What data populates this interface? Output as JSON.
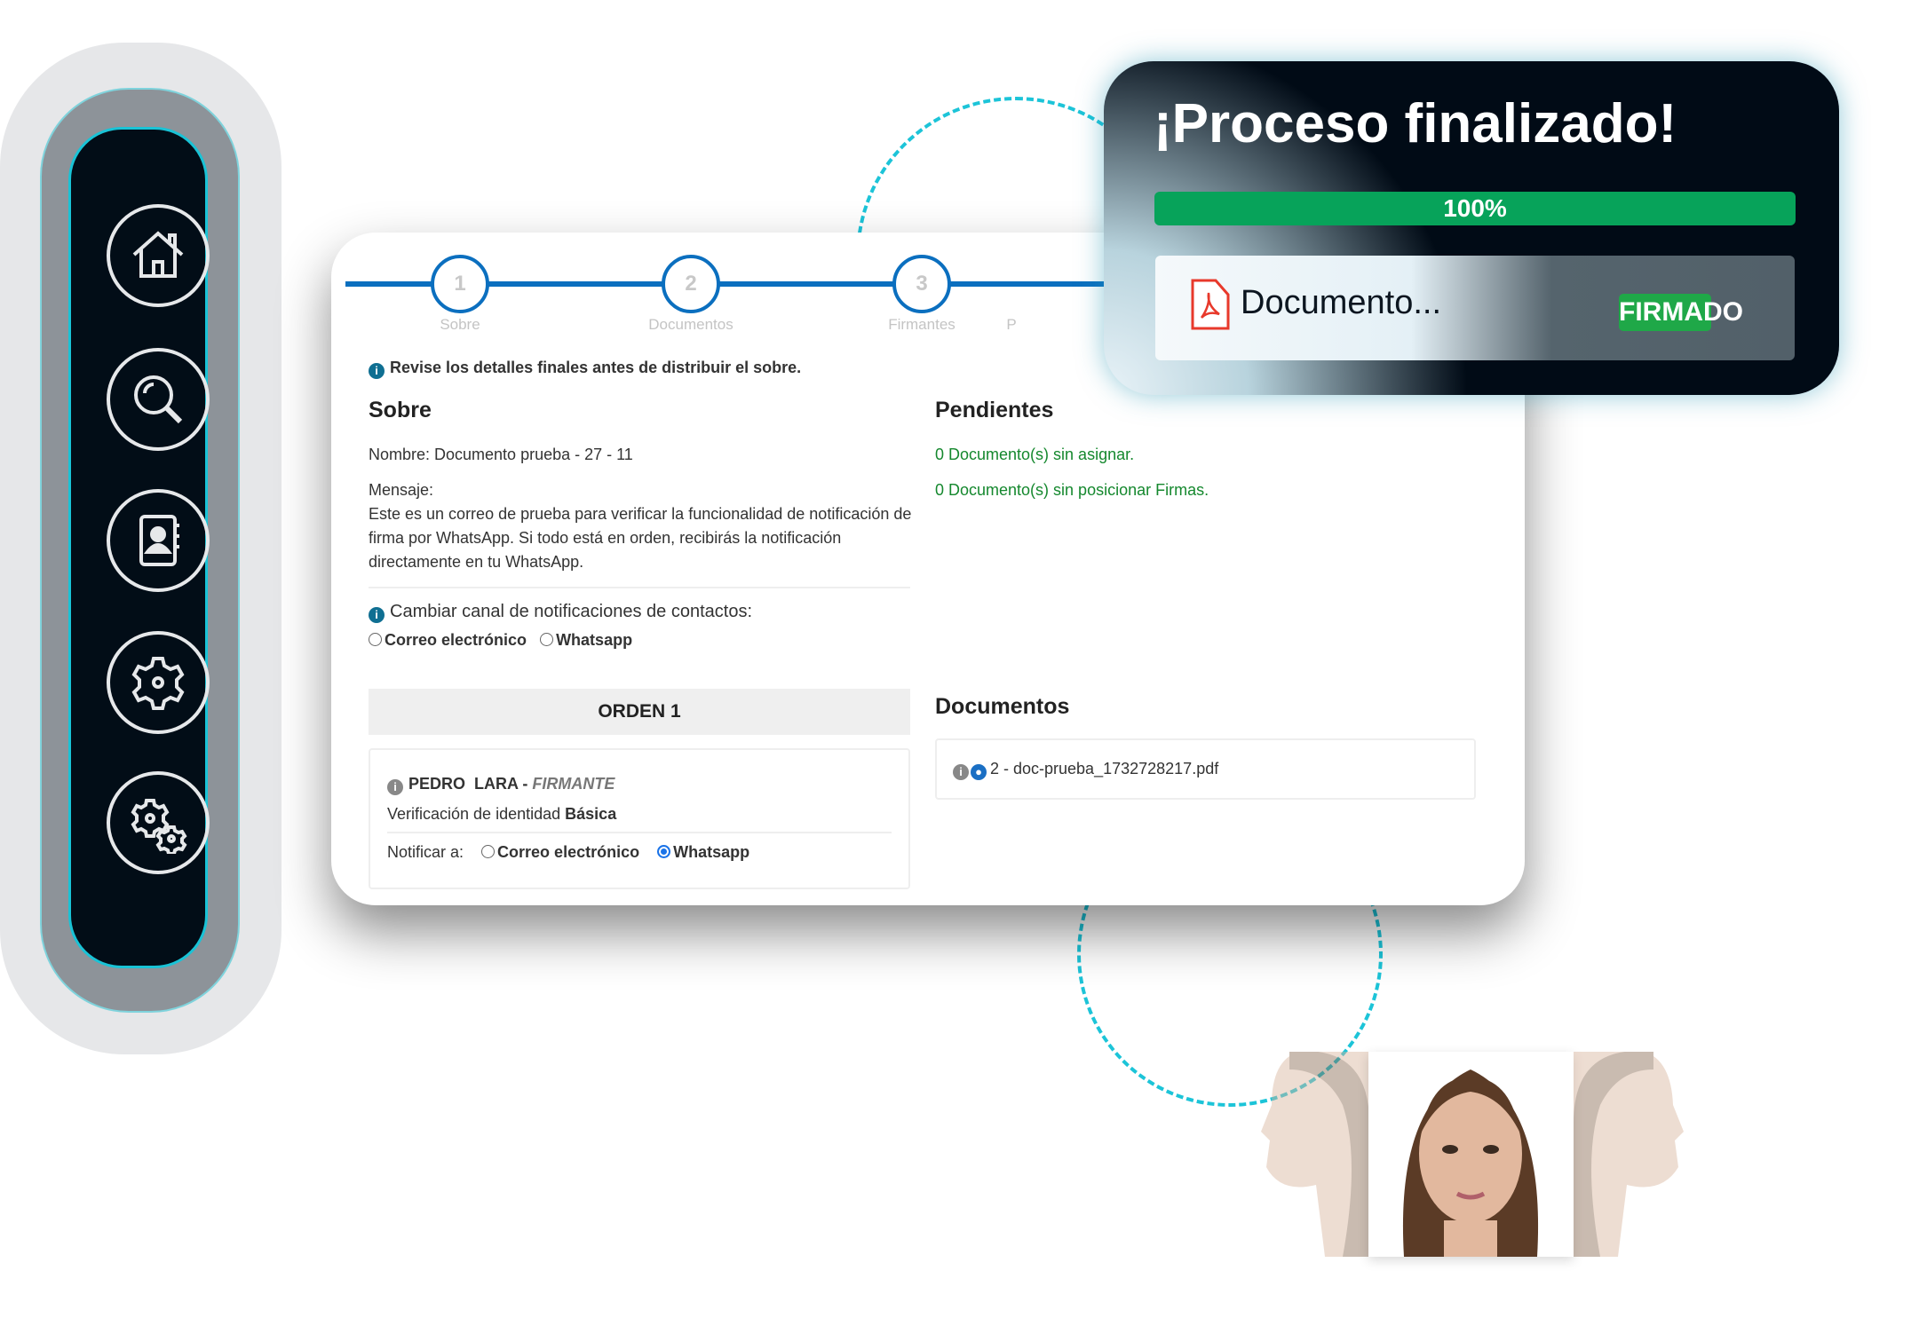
{
  "sidebar": {
    "items": [
      {
        "icon": "home-icon"
      },
      {
        "icon": "search-icon"
      },
      {
        "icon": "contacts-icon"
      },
      {
        "icon": "gear-icon"
      },
      {
        "icon": "gears-icon"
      }
    ]
  },
  "stepper": {
    "steps": [
      {
        "num": "1",
        "label": "Sobre"
      },
      {
        "num": "2",
        "label": "Documentos"
      },
      {
        "num": "3",
        "label": "Firmantes"
      },
      {
        "num": "",
        "label": "P"
      }
    ]
  },
  "review": {
    "info": "Revise los detalles finales antes de distribuir el sobre."
  },
  "sobre": {
    "heading": "Sobre",
    "nombre": "Nombre: Documento prueba - 27 - 11",
    "mensaje_label": "Mensaje:",
    "mensaje_lines": [
      "Este es un correo de prueba para verificar la funcionalidad de notificación de",
      "firma por WhatsApp. Si todo está en orden, recibirás la notificación",
      "directamente en tu WhatsApp."
    ],
    "canal_label": "Cambiar canal de notificaciones de contactos:",
    "canal_options": [
      "Correo electrónico",
      "Whatsapp"
    ]
  },
  "orden": {
    "title": "ORDEN 1",
    "signer_first": "PEDRO",
    "signer_last": "LARA",
    "separator": "-",
    "role": "FIRMANTE",
    "verif_label": "Verificación de identidad",
    "verif_level": "Básica",
    "notify_label": "Notificar a:",
    "notify_options": [
      "Correo electrónico",
      "Whatsapp"
    ],
    "notify_selected": "Whatsapp"
  },
  "pendientes": {
    "heading": "Pendientes",
    "items": [
      "0 Documento(s) sin asignar.",
      "0 Documento(s) sin posicionar Firmas."
    ]
  },
  "documentos": {
    "heading": "Documentos",
    "items": [
      "2 - doc-prueba_1732728217.pdf"
    ]
  },
  "popup": {
    "title": "¡Proceso finalizado!",
    "progress_label": "100%",
    "progress": 100,
    "doc_name": "Documento...",
    "status": "FIRMADO"
  },
  "colors": {
    "accent": "#0b6fbf",
    "success": "#07a35a",
    "badge": "#1fa848",
    "sidebar_dark": "#020d17",
    "cyan": "#19c3d6"
  }
}
